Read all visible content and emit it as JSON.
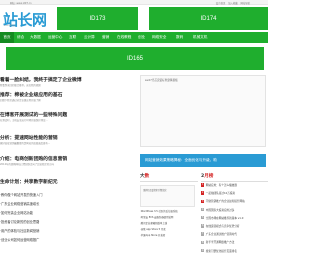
{
  "topbar": {
    "left_text": "网址: www.id97.cn",
    "right_links": [
      "设为首页",
      "加入收藏",
      "网站导航"
    ]
  },
  "logo": {
    "text": "站长网",
    "sub": "www.id97.cn"
  },
  "ads": {
    "ad_173": "ID173",
    "ad_174": "ID174",
    "ad_165": "ID165"
  },
  "nav": {
    "items": [
      "首页",
      "综合",
      "大数据",
      "运营中心",
      "互联",
      "云计算",
      "营销",
      "在线教程",
      "创业",
      "网络安全",
      "数码",
      "机械文机"
    ]
  },
  "main_image": {
    "caption": "sw27光芯安装标准建筑模板"
  },
  "articles": [
    {
      "title": "看着一脸纠结，我终于搞定了企业微博",
      "desc": "我看到来回的联合推荐，这位我的视频"
    },
    {
      "title": "推荐：棉被企业级应用的基石",
      "desc": "回想下我们通过对企业级应用开始了解"
    },
    {
      "title": "在博客开展测试的一些特殊问题",
      "desc": "在测试时，主机安全运行时将开始保护测试..."
    },
    {
      "title": "分析：提速网站性能的营销",
      "desc": "做好高效营销最重要的是网站的加载速度更有..."
    },
    {
      "title": "介绍：电商创新团购的信息营销",
      "desc": "2012年的团购网站已经纷纷走向了比较稳定的方向"
    },
    {
      "title": "生命计划：共享数字新纪元",
      "desc": ""
    }
  ],
  "banner": {
    "text": "网站营销效果策略揭秘：全面优化与升级，助"
  },
  "left_list": [
    "·教你做个网站开发的快速入门",
    "·广东企业网络营销高速增长",
    "·如何完善企业网站功能",
    "·投资者讨论新的的创业思路",
    "·用户的体验与社区新闻营销",
    "·创业公司如何运营网络推广"
  ],
  "hot_box": {
    "title_plain": "大",
    "title_red": "数",
    "thumb_caption": "[推荐]百度搜索引擎优化",
    "items": [
      "·WordPress 3.5 社区的反垃圾系统",
      "·阿里云 ECS 云服务器使用说明",
      "·腾讯企业邮箱新版本上线",
      "·谷歌 app Store 5 月底",
      "·苹果App Store 开发者"
    ]
  },
  "rank_box": {
    "title_plain": "2",
    "title_red": "月榜",
    "items": [
      {
        "num": "1",
        "text": "网站应用：有个怎么播放器"
      },
      {
        "num": "2",
        "text": "一起拍团队接过10万投资"
      },
      {
        "num": "3",
        "text": "不做营销推广的企业如何提升网站"
      },
      {
        "num": "4",
        "text": "中国国家大投资应用过多"
      },
      {
        "num": "5",
        "text": "全国市场在网站推荐新版本 v1.0"
      },
      {
        "num": "6",
        "text": "在线运营模式与竞争优势分析"
      },
      {
        "num": "7",
        "text": "广东企业通过推广营销时代"
      },
      {
        "num": "8",
        "text": "新手学开通网络推广方法"
      },
      {
        "num": "9",
        "text": "搜索引擎优化提升页面排名"
      }
    ]
  },
  "colors": {
    "brand_green": "#1fae2e",
    "brand_blue": "#2a9bd4",
    "accent_red": "#d42424"
  }
}
